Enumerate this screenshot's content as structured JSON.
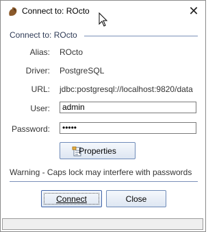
{
  "window": {
    "title": "Connect to: ROcto",
    "close_glyph": "✕"
  },
  "group": {
    "title": "Connect to: ROcto"
  },
  "form": {
    "alias_label": "Alias:",
    "alias_value": "ROcto",
    "driver_label": "Driver:",
    "driver_value": "PostgreSQL",
    "url_label": "URL:",
    "url_value": "jdbc:postgresql://localhost:9820/data",
    "user_label": "User:",
    "user_value": "admin",
    "password_label": "Password:",
    "password_value": "•••••"
  },
  "buttons": {
    "properties": "Properties",
    "connect": "Connect",
    "close": "Close"
  },
  "warning": "Warning - Caps lock may interfere with passwords",
  "status_text": ""
}
